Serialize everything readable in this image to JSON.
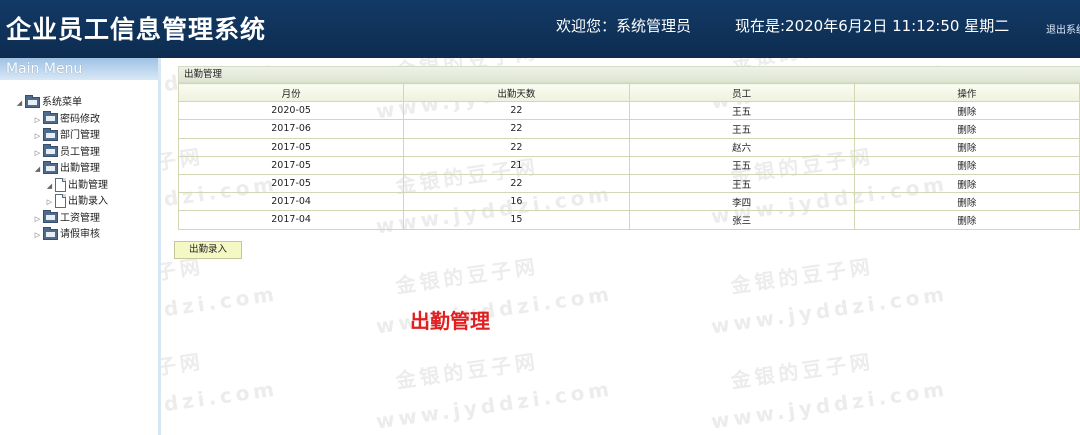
{
  "header": {
    "title": "企业员工信息管理系统",
    "welcome": "欢迎您：系统管理员",
    "clock": "现在是:2020年6月2日 11:12:50 星期二",
    "logout": "退出系统"
  },
  "sidebar": {
    "title": "Main Menu",
    "tree": [
      {
        "label": "系统菜单",
        "arrow": "◢",
        "icon": "folder-icon"
      },
      {
        "label": "密码修改",
        "arrow": "▷",
        "icon": "folder-icon"
      },
      {
        "label": "部门管理",
        "arrow": "▷",
        "icon": "folder-icon"
      },
      {
        "label": "员工管理",
        "arrow": "▷",
        "icon": "folder-icon"
      },
      {
        "label": "出勤管理",
        "arrow": "◢",
        "icon": "folder-icon"
      },
      {
        "label": "出勤管理",
        "arrow": "◢",
        "icon": "doc-icon"
      },
      {
        "label": "出勤录入",
        "arrow": "▷",
        "icon": "doc-icon"
      },
      {
        "label": "工资管理",
        "arrow": "▷",
        "icon": "folder-icon"
      },
      {
        "label": "请假审核",
        "arrow": "▷",
        "icon": "folder-icon"
      }
    ]
  },
  "panel": {
    "title": "出勤管理",
    "columns": [
      "月份",
      "出勤天数",
      "员工",
      "操作"
    ],
    "rows": [
      [
        "2020-05",
        "22",
        "王五",
        "删除"
      ],
      [
        "2017-06",
        "22",
        "王五",
        "删除"
      ],
      [
        "2017-05",
        "22",
        "赵六",
        "删除"
      ],
      [
        "2017-05",
        "21",
        "王五",
        "删除"
      ],
      [
        "2017-05",
        "22",
        "王五",
        "删除"
      ],
      [
        "2017-04",
        "16",
        "李四",
        "删除"
      ],
      [
        "2017-04",
        "15",
        "张三",
        "删除"
      ]
    ],
    "add_button": "出勤录入"
  },
  "caption": "出勤管理",
  "watermark": {
    "line1": "金银的豆子网",
    "line2": "www.jyddzi.com"
  }
}
